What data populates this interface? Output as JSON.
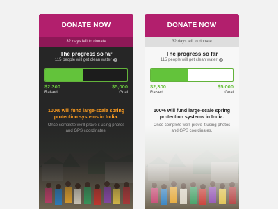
{
  "cards": [
    {
      "theme": "dark",
      "donate_label": "DONATE NOW",
      "days_left": "32 days left to donate",
      "progress_title": "The progress so far",
      "progress_sub": "115 people will get clean water",
      "info_icon": "?",
      "progress_fraction": 0.46,
      "raised_amount": "$2,300",
      "raised_label": "Raised",
      "goal_amount": "$5,000",
      "goal_label": "Goal",
      "headline": "100% will fund large-scale spring protection systems in India.",
      "subline": "Once complete we'll prove it using photos and GPS coordinates."
    },
    {
      "theme": "light",
      "donate_label": "DONATE NOW",
      "days_left": "32 days left to donate",
      "progress_title": "The progress so far",
      "progress_sub": "115 people will get clean water",
      "info_icon": "?",
      "progress_fraction": 0.46,
      "raised_amount": "$2,300",
      "raised_label": "Raised",
      "goal_amount": "$5,000",
      "goal_label": "Goal",
      "headline": "100% will fund large-scale spring protection systems in India.",
      "subline": "Once complete we'll prove it using photos and GPS coordinates."
    }
  ],
  "colors": {
    "brand": "#b21f6d",
    "brand_dark": "#8e1857",
    "progress_green": "#63c33b",
    "accent_orange": "#ff9d1f"
  }
}
